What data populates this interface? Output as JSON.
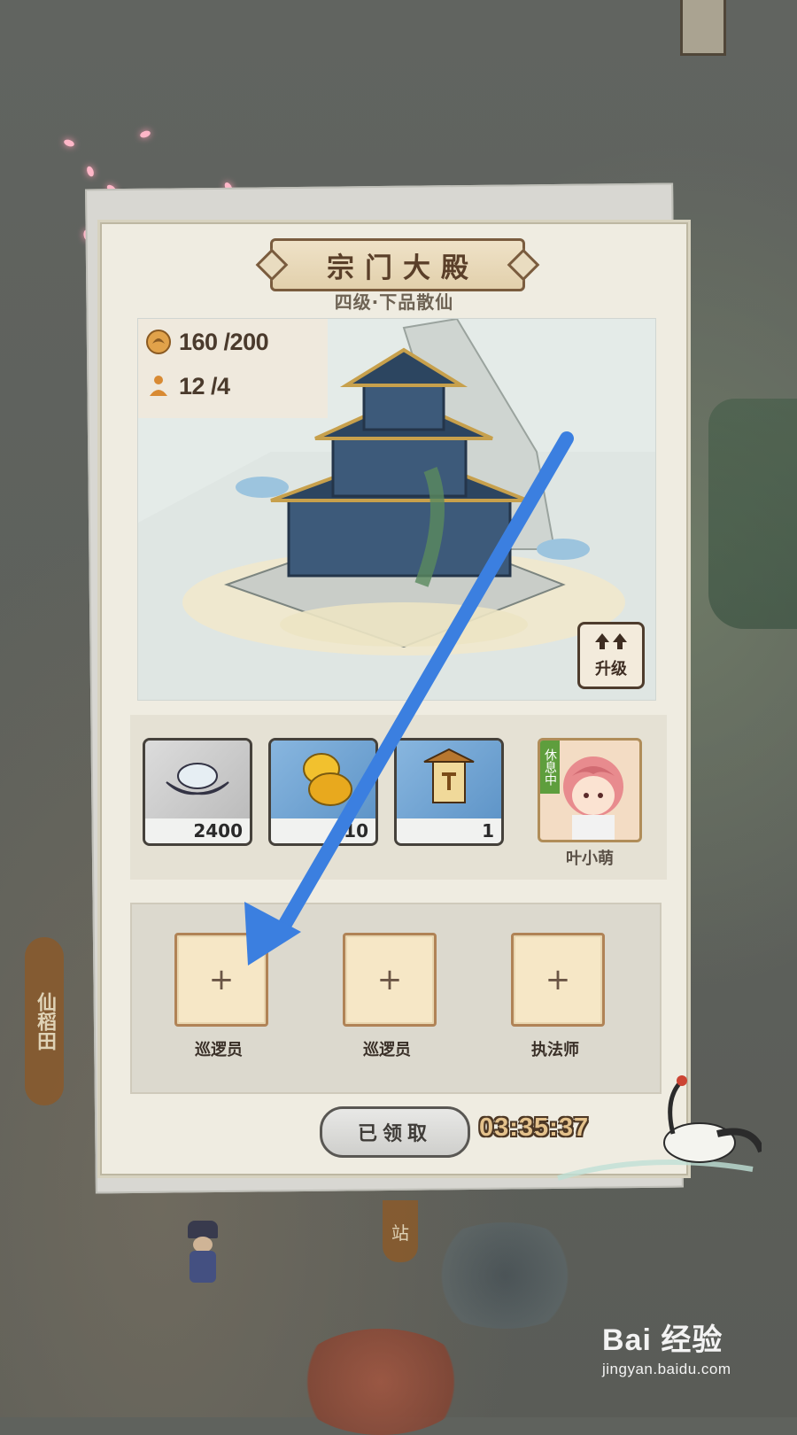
{
  "window": {
    "title": "宗门大殿",
    "subtitle": "四级·下品散仙"
  },
  "stats": {
    "disciples": "160 /200",
    "workers": "12 /4"
  },
  "upgrade": {
    "label": "升级"
  },
  "resources": [
    {
      "icon": "silver-ingot-icon",
      "count": "2400"
    },
    {
      "icon": "gold-gourd-icon",
      "count": "10"
    },
    {
      "icon": "token-plaque-icon",
      "count": "1"
    }
  ],
  "character": {
    "tag": "休息中",
    "name": "叶小萌"
  },
  "slots": [
    {
      "label": "巡逻员"
    },
    {
      "label": "巡逻员"
    },
    {
      "label": "执法师"
    }
  ],
  "reward": {
    "button": "已领取",
    "timer": "03:35:37"
  },
  "background": {
    "field_sign": "仙稻田",
    "station_sign": "站"
  },
  "watermark": {
    "brand": "Bai 经验",
    "url": "jingyan.baidu.com"
  },
  "colors": {
    "arrow": "#3b7fe0",
    "accent": "#7a5c3e",
    "timer": "#e4c28c"
  }
}
